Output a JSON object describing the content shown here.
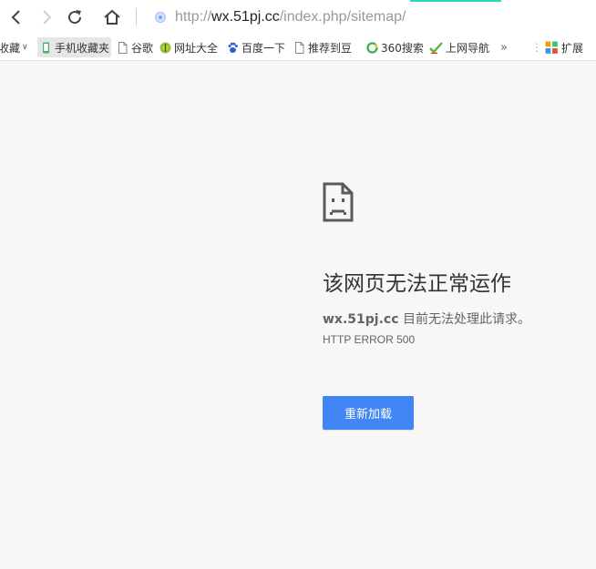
{
  "colors": {
    "accent": "#4285f4",
    "progress": "#2fd3b8",
    "page_bg": "#f7f7f7"
  },
  "toolbar": {
    "back_icon": "chevron-left-icon",
    "forward_icon": "chevron-right-icon",
    "reload_icon": "reload-icon",
    "home_icon": "home-icon",
    "url": {
      "scheme": "http://",
      "host": "wx.51pj.cc",
      "path": "/index.php/sitemap/"
    }
  },
  "bookmarks": {
    "items": [
      {
        "label": "收藏",
        "icon": "none"
      },
      {
        "label": "手机收藏夹",
        "icon": "phone-icon"
      },
      {
        "label": "谷歌",
        "icon": "page-icon"
      },
      {
        "label": "网址大全",
        "icon": "url-directory-icon"
      },
      {
        "label": "百度一下",
        "icon": "baidu-paw-icon"
      },
      {
        "label": "推荐到豆",
        "icon": "page-icon"
      },
      {
        "label": "360搜索",
        "icon": "360-search-icon"
      },
      {
        "label": "上网导航",
        "icon": "hao-nav-icon"
      },
      {
        "label": "扩展",
        "icon": "extensions-icon"
      }
    ],
    "overflow": "»"
  },
  "error": {
    "title": "该网页无法正常运作",
    "host": "wx.51pj.cc",
    "message": "目前无法处理此请求。",
    "code": "HTTP ERROR 500",
    "reload_label": "重新加载"
  }
}
